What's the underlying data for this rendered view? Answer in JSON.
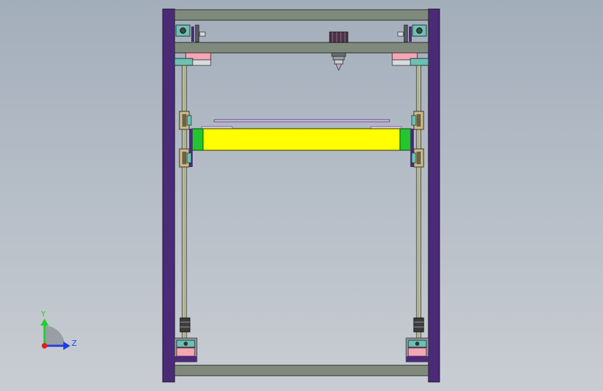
{
  "viewport": {
    "background_top": "#a3aebb",
    "background_bottom": "#c9cdd3"
  },
  "model": {
    "frame_color": "#4b2a78",
    "rail_color": "#7f8a7c",
    "rod_color": "#c8cca8",
    "bed_color": "#ffff00",
    "bed_end_color": "#22c72b",
    "motor_color": "#f2a7b5",
    "mount_color": "#6fbfb4",
    "bearing_color": "#c7b88a"
  },
  "triad": {
    "y_label": "Y",
    "z_label": "Z",
    "y_color": "#1fd12b",
    "z_color": "#1d3fe0",
    "origin_color": "#e01e1e"
  }
}
